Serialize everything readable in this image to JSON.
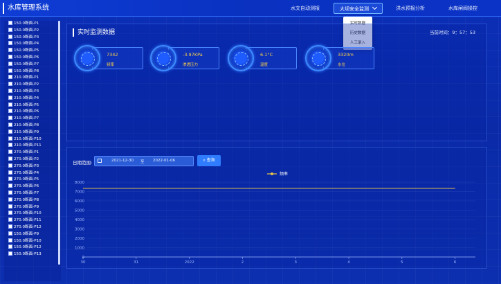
{
  "app": {
    "title": "水库管理系统"
  },
  "nav": {
    "items": [
      {
        "label": "水文自动测报"
      },
      {
        "label": "大坝安全监测"
      },
      {
        "label": "洪水预报分析"
      },
      {
        "label": "水库闸阀操控"
      }
    ],
    "dropdown": [
      "实时数据",
      "历史数据",
      "人工录入"
    ]
  },
  "sidebar": {
    "stations": [
      "150.0断面-P1",
      "150.0断面-P2",
      "150.0断面-P3",
      "150.0断面-P4",
      "150.0断面-P5",
      "150.0断面-P6",
      "150.0断面-P7",
      "150.0断面-P8",
      "210.0断面-P1",
      "210.0断面-P2",
      "210.0断面-P3",
      "210.0断面-P4",
      "210.0断面-P5",
      "210.0断面-P6",
      "210.0断面-P7",
      "210.0断面-P8",
      "210.0断面-P9",
      "210.0断面-P10",
      "210.0断面-P11",
      "270.0断面-P1",
      "270.0断面-P2",
      "270.0断面-P3",
      "270.0断面-P4",
      "270.0断面-P5",
      "270.0断面-P6",
      "270.0断面-P7",
      "270.0断面-P8",
      "270.0断面-P9",
      "270.0断面-P10",
      "270.0断面-P11",
      "270.0断面-P12",
      "150.0断面-P9",
      "150.0断面-P10",
      "150.0断面-P12",
      "150.0断面-P13"
    ]
  },
  "panel": {
    "title": "实时监测数据",
    "clock": "当前时间：9：57：53",
    "metrics": [
      {
        "value": "7342",
        "label": "频率"
      },
      {
        "value": "-3.97KPa",
        "label": "渗透压力"
      },
      {
        "value": "6.1°C",
        "label": "温度"
      },
      {
        "value": "3320m",
        "label": "水位"
      }
    ]
  },
  "query": {
    "range_label": "日期范围:",
    "start": "2021-12-30",
    "separator": "至",
    "end": "2022-01-06",
    "button": "查询"
  },
  "chart_data": {
    "type": "line",
    "legend": "频率",
    "x": [
      "30",
      "31",
      "2022",
      "2",
      "3",
      "4",
      "5",
      "6"
    ],
    "series": [
      {
        "name": "频率",
        "values": [
          7342,
          7342,
          7342,
          7342,
          7342,
          7342,
          7342,
          7342
        ]
      }
    ],
    "yticks": [
      0,
      1000,
      2000,
      3000,
      4000,
      5000,
      6000,
      7000,
      8000
    ],
    "ylim": [
      0,
      8000
    ],
    "colors": {
      "series": "#e6c44a",
      "axis": "#9fb8ff"
    }
  }
}
